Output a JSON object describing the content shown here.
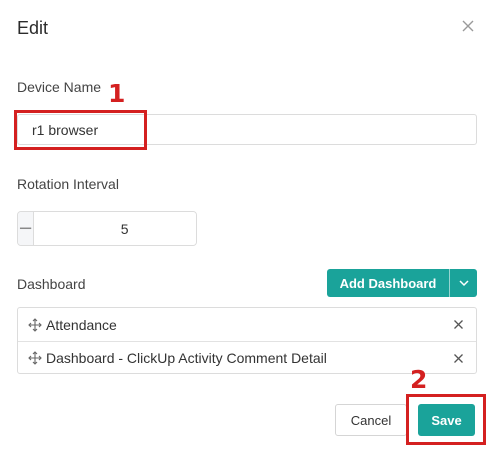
{
  "dialog": {
    "title": "Edit",
    "close_icon": "close-icon"
  },
  "device_name": {
    "label": "Device Name",
    "value": "r1 browser"
  },
  "rotation_interval": {
    "label": "Rotation Interval",
    "value": "5",
    "decrement_symbol": "−",
    "increment_symbol": "+"
  },
  "dashboard": {
    "label": "Dashboard",
    "add_button_label": "Add Dashboard",
    "items": [
      {
        "label": "Attendance"
      },
      {
        "label": "Dashboard - ClickUp Activity Comment Detail"
      }
    ]
  },
  "footer": {
    "cancel_label": "Cancel",
    "save_label": "Save"
  },
  "annotations": {
    "marker_1": "1",
    "marker_2": "2"
  },
  "colors": {
    "accent": "#1aa39a",
    "annotation": "#d42020"
  }
}
